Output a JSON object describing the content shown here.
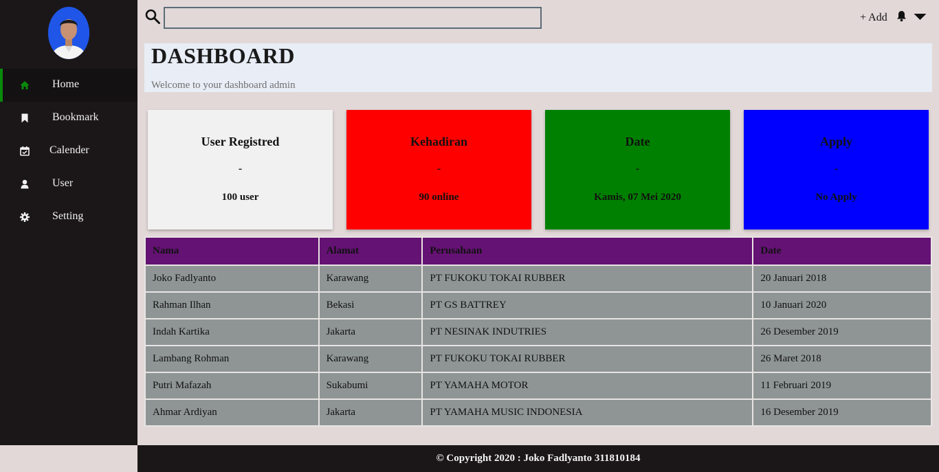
{
  "sidebar": {
    "items": [
      {
        "label": "Home",
        "icon": "home-icon"
      },
      {
        "label": "Bookmark",
        "icon": "bookmark-icon"
      },
      {
        "label": "Calender",
        "icon": "calendar-icon"
      },
      {
        "label": "User",
        "icon": "user-icon"
      },
      {
        "label": "Setting",
        "icon": "gear-icon"
      }
    ]
  },
  "topbar": {
    "search_value": "",
    "add_label": "+ Add"
  },
  "header": {
    "title": "DASHBOARD",
    "subtitle": "Welcome to your dashboard admin"
  },
  "cards": [
    {
      "title": "User Registred",
      "dash": "-",
      "value": "100 user",
      "color": "#f1f1f1"
    },
    {
      "title": "Kehadiran",
      "dash": "-",
      "value": "90 online",
      "color": "#ff0000"
    },
    {
      "title": "Date",
      "dash": "-",
      "value": "Kamis, 07 Mei 2020",
      "color": "#008000"
    },
    {
      "title": "Apply",
      "dash": "-",
      "value": "No Apply",
      "color": "#0000ff"
    }
  ],
  "table": {
    "headers": [
      "Nama",
      "Alamat",
      "Perusahaan",
      "Date"
    ],
    "rows": [
      [
        "Joko Fadlyanto",
        "Karawang",
        "PT FUKOKU TOKAI RUBBER",
        "20 Januari 2018"
      ],
      [
        "Rahman Ilhan",
        "Bekasi",
        "PT GS BATTREY",
        "10 Januari 2020"
      ],
      [
        "Indah Kartika",
        "Jakarta",
        "PT NESINAK INDUTRIES",
        "26 Desember 2019"
      ],
      [
        "Lambang Rohman",
        "Karawang",
        "PT FUKOKU TOKAI RUBBER",
        "26 Maret 2018"
      ],
      [
        "Putri Mafazah",
        "Sukabumi",
        "PT YAMAHA MOTOR",
        "11 Februari 2019"
      ],
      [
        "Ahmar Ardiyan",
        "Jakarta",
        "PT YAMAHA MUSIC INDONESIA",
        "16 Desember 2019"
      ]
    ]
  },
  "footer": {
    "text": "© Copyright 2020 : Joko Fadlyanto 311810184"
  },
  "colors": {
    "sidebar_bg": "#1b1718",
    "active_accent": "#0a8a0a",
    "table_header_bg": "#641273",
    "table_cell_bg": "#8f9595"
  }
}
